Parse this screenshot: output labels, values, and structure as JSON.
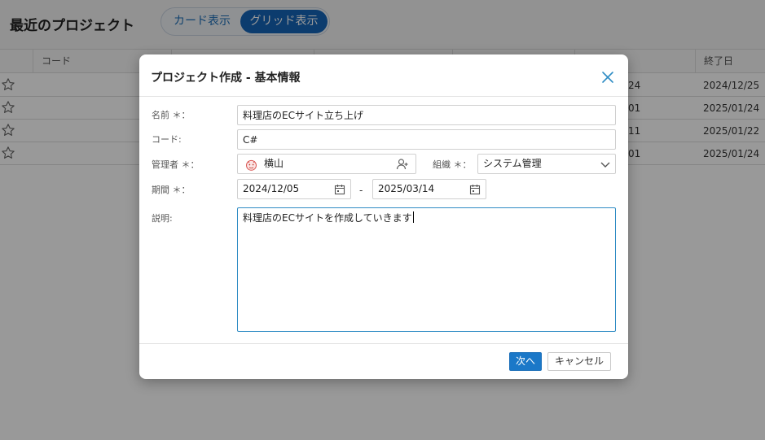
{
  "page": {
    "title": "最近のプロジェクト",
    "view_toggle": {
      "card_label": "カード表示",
      "grid_label": "グリッド表示"
    }
  },
  "grid": {
    "columns": {
      "code": "コード",
      "end_date": "終了日"
    },
    "rows": [
      {
        "date_partial": "24",
        "end_date": "2024/12/25"
      },
      {
        "date_partial": "01",
        "end_date": "2025/01/24"
      },
      {
        "date_partial": "11",
        "end_date": "2025/01/22"
      },
      {
        "date_partial": "01",
        "end_date": "2025/01/24"
      }
    ]
  },
  "dialog": {
    "title": "プロジェクト作成 - 基本情報",
    "name_label": "名前 ＊：",
    "name_value": "料理店のECサイト立ち上げ",
    "code_label": "コード:",
    "code_value": "C#",
    "manager_label": "管理者 ＊：",
    "manager_value": "横山",
    "org_label": "組織 ＊：",
    "org_value": "システム管理",
    "period_label": "期間 ＊：",
    "start_date": "2024/12/05",
    "period_separator": "-",
    "end_date": "2025/03/14",
    "description_label": "説明:",
    "description_value": "料理店のECサイトを作成していきます",
    "next_button": "次へ",
    "cancel_button": "キャンセル"
  },
  "colors": {
    "accent": "#1b78c8",
    "toggle_active": "#1565b8",
    "focus_border": "#2f8cc4"
  }
}
